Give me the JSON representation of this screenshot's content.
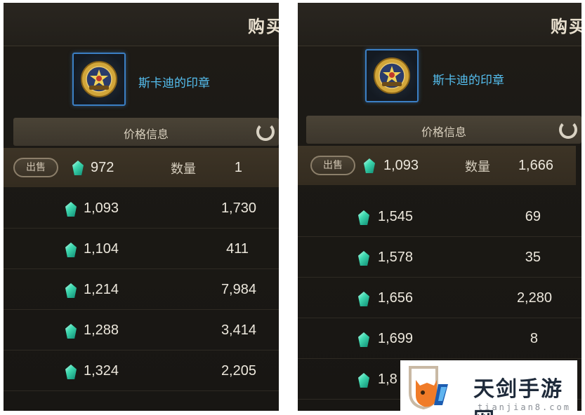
{
  "colors": {
    "background": "#1b1915",
    "item_name": "#55bff0",
    "gem": "#3fd9b0",
    "text": "#ece7dc"
  },
  "panels": [
    {
      "buy_title": "购买",
      "item_name": "斯卡迪的印章",
      "price_header": "价格信息",
      "sale": {
        "button": "出售",
        "price": "972",
        "qty_label": "数量",
        "qty": "1"
      },
      "rows": [
        {
          "price": "1,093",
          "qty": "1,730"
        },
        {
          "price": "1,104",
          "qty": "411"
        },
        {
          "price": "1,214",
          "qty": "7,984"
        },
        {
          "price": "1,288",
          "qty": "3,414"
        },
        {
          "price": "1,324",
          "qty": "2,205"
        }
      ]
    },
    {
      "buy_title": "购买",
      "item_name": "斯卡迪的印章",
      "price_header": "价格信息",
      "sale": {
        "button": "出售",
        "price": "1,093",
        "qty_label": "数量",
        "qty": "1,666"
      },
      "rows": [
        {
          "price": "1,545",
          "qty": "69"
        },
        {
          "price": "1,578",
          "qty": "35"
        },
        {
          "price": "1,656",
          "qty": "2,280"
        },
        {
          "price": "1,699",
          "qty": "8"
        },
        {
          "price": "1,8",
          "qty": ""
        }
      ]
    }
  ],
  "watermark": {
    "title": "天剑手游网",
    "url": "tianjian8.com"
  }
}
